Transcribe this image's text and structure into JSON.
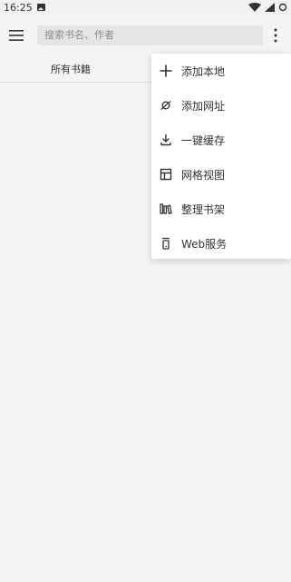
{
  "status_bar": {
    "time": "16:25",
    "icons": [
      "image-icon",
      "wifi-icon",
      "signal-icon",
      "battery-icon"
    ]
  },
  "toolbar": {
    "menu_icon": "hamburger-menu-icon",
    "search_placeholder": "搜索书名、作者",
    "more_icon": "more-vertical-icon"
  },
  "tabs": [
    {
      "label": "所有书籍"
    }
  ],
  "menu": {
    "items": [
      {
        "label": "添加本地",
        "icon": "plus-icon"
      },
      {
        "label": "添加网址",
        "icon": "planet-icon"
      },
      {
        "label": "一键缓存",
        "icon": "download-icon"
      },
      {
        "label": "网格视图",
        "icon": "grid-view-icon"
      },
      {
        "label": "整理书架",
        "icon": "bookshelf-icon"
      },
      {
        "label": "Web服务",
        "icon": "web-service-icon"
      }
    ]
  },
  "colors": {
    "background": "#f4f4f4",
    "menu_background": "#ffffff",
    "text": "#333333",
    "search_background": "#e5e5e5"
  }
}
